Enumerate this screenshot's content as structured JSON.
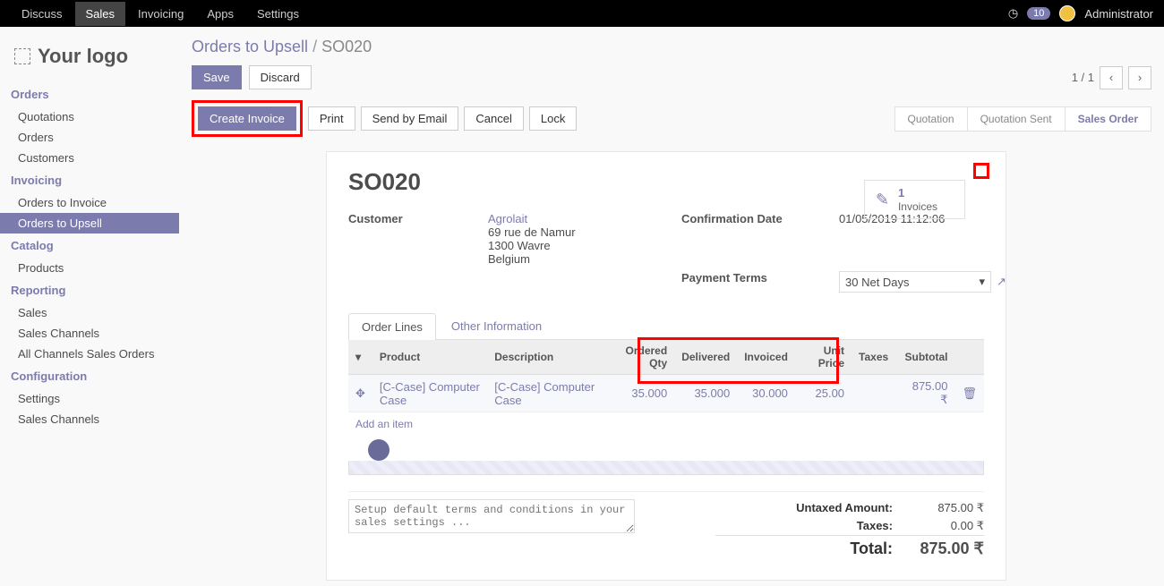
{
  "topbar": {
    "items": [
      "Discuss",
      "Sales",
      "Invoicing",
      "Apps",
      "Settings"
    ],
    "active": "Sales",
    "notifications": 10,
    "user": "Administrator"
  },
  "logo": {
    "text": "Your logo"
  },
  "sidebar": {
    "groups": [
      {
        "title": "Orders",
        "items": [
          "Quotations",
          "Orders",
          "Customers"
        ]
      },
      {
        "title": "Invoicing",
        "items": [
          "Orders to Invoice",
          "Orders to Upsell"
        ],
        "active": "Orders to Upsell"
      },
      {
        "title": "Catalog",
        "items": [
          "Products"
        ]
      },
      {
        "title": "Reporting",
        "items": [
          "Sales",
          "Sales Channels",
          "All Channels Sales Orders"
        ]
      },
      {
        "title": "Configuration",
        "items": [
          "Settings",
          "Sales Channels"
        ]
      }
    ]
  },
  "breadcrumb": {
    "parent": "Orders to Upsell",
    "current": "SO020"
  },
  "header_buttons": {
    "save": "Save",
    "discard": "Discard"
  },
  "pager": {
    "text": "1 / 1"
  },
  "action_buttons": {
    "create_invoice": "Create Invoice",
    "print": "Print",
    "send_email": "Send by Email",
    "cancel": "Cancel",
    "lock": "Lock"
  },
  "statusbar": {
    "steps": [
      "Quotation",
      "Quotation Sent",
      "Sales Order"
    ],
    "active": "Sales Order"
  },
  "record": {
    "name": "SO020",
    "stat": {
      "count": "1",
      "label": "Invoices"
    },
    "fields": {
      "customer_label": "Customer",
      "customer_name": "Agrolait",
      "customer_addr1": "69 rue de Namur",
      "customer_addr2": "1300 Wavre",
      "customer_addr3": "Belgium",
      "confirmation_label": "Confirmation Date",
      "confirmation_value": "01/05/2019 11:12:06",
      "payment_terms_label": "Payment Terms",
      "payment_terms_value": "30 Net Days"
    }
  },
  "tabs": {
    "order_lines": "Order Lines",
    "other": "Other Information"
  },
  "table": {
    "headers": {
      "product": "Product",
      "description": "Description",
      "ordered": "Ordered Qty",
      "delivered": "Delivered",
      "invoiced": "Invoiced",
      "unit_price": "Unit Price",
      "taxes": "Taxes",
      "subtotal": "Subtotal"
    },
    "rows": [
      {
        "product": "[C-Case] Computer Case",
        "description": "[C-Case] Computer Case",
        "ordered": "35.000",
        "delivered": "35.000",
        "invoiced": "30.000",
        "unit_price": "25.00",
        "taxes": "",
        "subtotal": "875.00",
        "currency": "₹"
      }
    ],
    "add_item": "Add an item"
  },
  "terms_placeholder": "Setup default terms and conditions in your sales settings ...",
  "totals": {
    "untaxed_label": "Untaxed Amount:",
    "untaxed": "875.00",
    "taxes_label": "Taxes:",
    "taxes": "0.00",
    "total_label": "Total:",
    "total": "875.00",
    "currency": "₹"
  }
}
